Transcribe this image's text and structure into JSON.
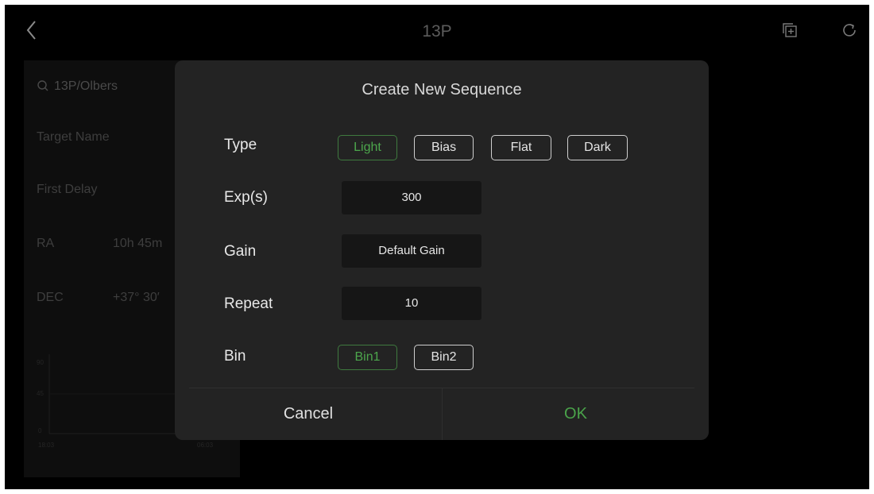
{
  "header": {
    "title": "13P",
    "icons": [
      "back-icon",
      "add-copy-icon",
      "refresh-icon"
    ]
  },
  "background": {
    "search_text": "13P/Olbers",
    "rows": [
      {
        "label": "Target Name",
        "value": ""
      },
      {
        "label": "First Delay",
        "value": ""
      },
      {
        "label": "RA",
        "value": "10h 45m"
      },
      {
        "label": "DEC",
        "value": "+37° 30′"
      }
    ],
    "chart_axis": {
      "y_top": "90",
      "y_mid": "45",
      "y_bottom": "0",
      "x_left": "18:03",
      "x_right": "06:03"
    }
  },
  "dialog": {
    "title": "Create New Sequence",
    "type": {
      "label": "Type",
      "options": [
        "Light",
        "Bias",
        "Flat",
        "Dark"
      ],
      "selected": "Light"
    },
    "exposure": {
      "label": "Exp(s)",
      "value": "300"
    },
    "gain": {
      "label": "Gain",
      "value": "Default Gain"
    },
    "repeat": {
      "label": "Repeat",
      "value": "10"
    },
    "bin": {
      "label": "Bin",
      "options": [
        "Bin1",
        "Bin2"
      ],
      "selected": "Bin1"
    },
    "cancel_label": "Cancel",
    "ok_label": "OK"
  },
  "colors": {
    "accent_green": "#4ca64c",
    "dialog_bg": "#232323",
    "screen_bg": "#000000"
  }
}
